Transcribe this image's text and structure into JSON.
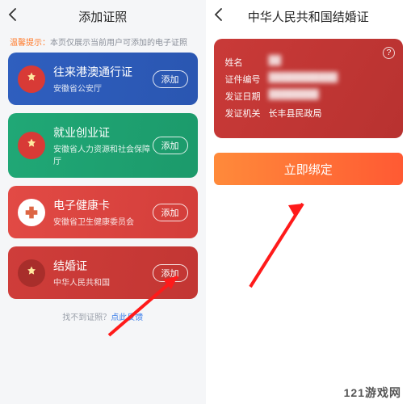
{
  "left": {
    "title": "添加证照",
    "tip_label": "温馨提示：",
    "tip_text": "本页仅展示当前用户可添加的电子证照",
    "add_label": "添加",
    "cards": [
      {
        "title": "往来港澳通行证",
        "sub": "安徽省公安厅"
      },
      {
        "title": "就业创业证",
        "sub": "安徽省人力资源和社会保障厅"
      },
      {
        "title": "电子健康卡",
        "sub": "安徽省卫生健康委员会"
      },
      {
        "title": "结婚证",
        "sub": "中华人民共和国"
      }
    ],
    "footer_text": "找不到证照？",
    "footer_link": "点此反馈"
  },
  "right": {
    "title": "中华人民共和国结婚证",
    "help_icon": "?",
    "fields": {
      "name_label": "姓名",
      "name_value": "██",
      "id_label": "证件编号",
      "id_value": "███████████",
      "date_label": "发证日期",
      "date_value": "████████",
      "org_label": "发证机关",
      "org_value": "长丰县民政局"
    },
    "bind_button": "立即绑定"
  },
  "watermark": "121游戏网"
}
